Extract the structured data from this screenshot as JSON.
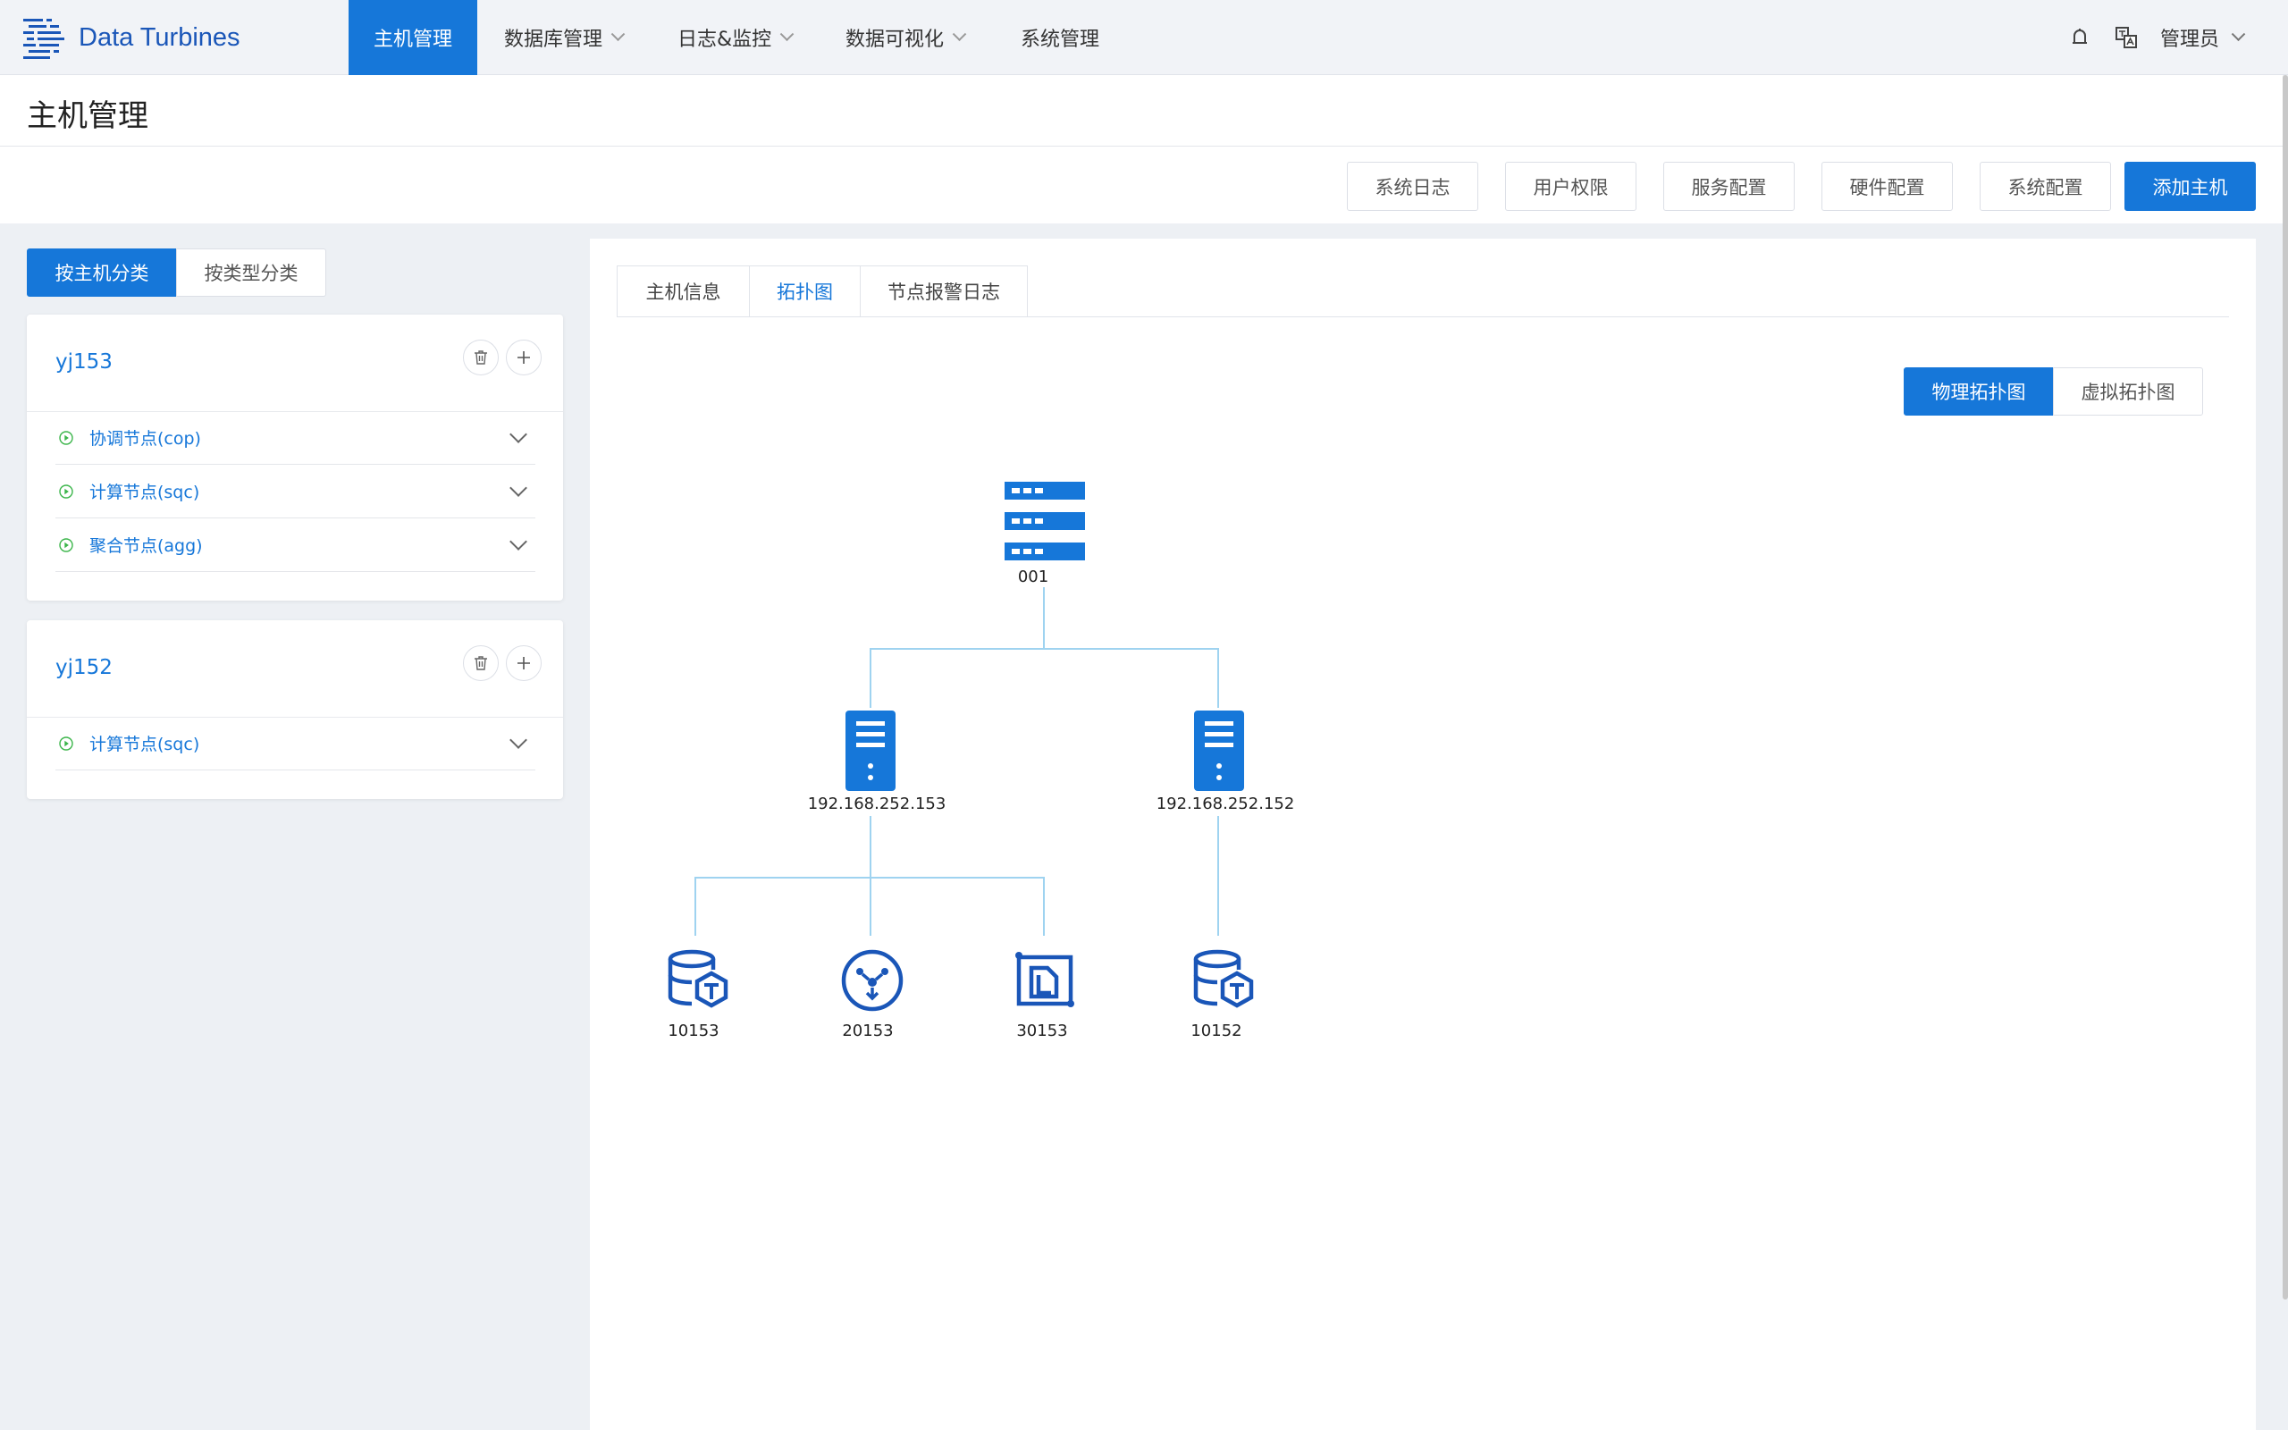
{
  "brand": {
    "name": "Data Turbines"
  },
  "nav": {
    "items": [
      {
        "label": "主机管理",
        "active": true
      },
      {
        "label": "数据库管理",
        "dropdown": true
      },
      {
        "label": "日志&监控",
        "dropdown": true
      },
      {
        "label": "数据可视化",
        "dropdown": true
      },
      {
        "label": "系统管理"
      }
    ],
    "user": "管理员"
  },
  "page": {
    "title": "主机管理"
  },
  "toolbar": {
    "buttons": [
      "系统日志",
      "用户权限",
      "服务配置",
      "硬件配置",
      "系统配置"
    ],
    "primary": "添加主机"
  },
  "left": {
    "group_tabs": [
      "按主机分类",
      "按类型分类"
    ],
    "hosts": [
      {
        "name": "yj153",
        "nodes": [
          "协调节点(cop)",
          "计算节点(sqc)",
          "聚合节点(agg)"
        ]
      },
      {
        "name": "yj152",
        "nodes": [
          "计算节点(sqc)"
        ]
      }
    ]
  },
  "main": {
    "tabs": [
      "主机信息",
      "拓扑图",
      "节点报警日志"
    ],
    "active_tab": "拓扑图",
    "view_toggle": [
      "物理拓扑图",
      "虚拟拓扑图"
    ],
    "topology": {
      "root": "001",
      "servers": [
        "192.168.252.153",
        "192.168.252.152"
      ],
      "services": [
        "10153",
        "20153",
        "30153",
        "10152"
      ]
    }
  },
  "colors": {
    "accent": "#1677d9",
    "icon": "#1a56b8",
    "link_line": "#9fd3f0",
    "node_green": "#3bb54a"
  }
}
